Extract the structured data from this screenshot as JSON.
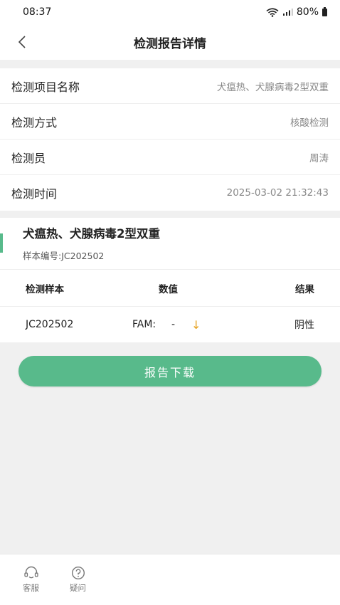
{
  "status_bar": {
    "time": "08:37",
    "battery": "80%"
  },
  "nav": {
    "title": "检测报告详情"
  },
  "info": [
    {
      "label": "检测项目名称",
      "value": "犬瘟热、犬腺病毒2型双重"
    },
    {
      "label": "检测方式",
      "value": "核酸检测"
    },
    {
      "label": "检测员",
      "value": "周涛"
    },
    {
      "label": "检测时间",
      "value": "2025-03-02 21:32:43"
    }
  ],
  "result": {
    "title": "犬瘟热、犬腺病毒2型双重",
    "sample_no": "样本编号:JC202502",
    "headers": {
      "sample": "检测样本",
      "value": "数值",
      "result": "结果"
    },
    "row": {
      "sample": "JC202502",
      "fam_label": "FAM:",
      "fam_value": "-",
      "arrow": "↓",
      "result": "阴性"
    }
  },
  "download_label": "报告下载",
  "tabs": {
    "service": "客服",
    "question": "疑问"
  },
  "colors": {
    "accent": "#58ba8b",
    "arrow": "#e6a11e"
  }
}
